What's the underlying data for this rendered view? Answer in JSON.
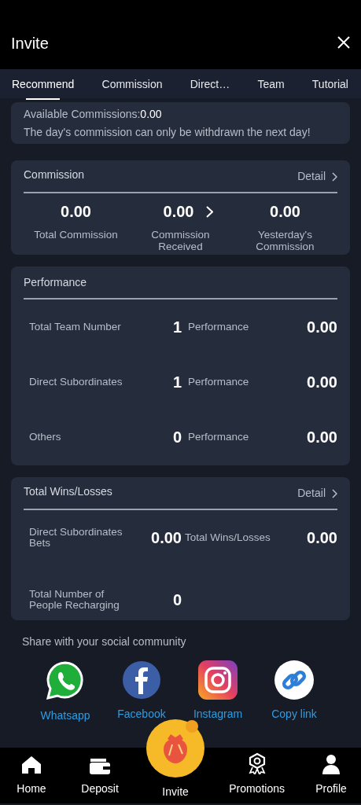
{
  "header": {
    "title": "Invite"
  },
  "tabs": [
    {
      "label": "Recommend",
      "selected": true
    },
    {
      "label": "Commission",
      "selected": false
    },
    {
      "label": "Direct…",
      "selected": false
    },
    {
      "label": "Team",
      "selected": false
    },
    {
      "label": "Tutorial",
      "selected": false
    }
  ],
  "balance_card": {
    "label": "Available Commissions:",
    "value": "0.00",
    "note": "The day's commission can only be withdrawn the next day!"
  },
  "commission_card": {
    "title": "Commission",
    "detail_link": "Detail",
    "stats": [
      {
        "value": "0.00",
        "label": "Total Commission",
        "has_arrow": false
      },
      {
        "value": "0.00",
        "label": "Commission Received",
        "has_arrow": true
      },
      {
        "value": "0.00",
        "label": "Yesterday's Commission",
        "has_arrow": false
      }
    ]
  },
  "performance_card": {
    "title": "Performance",
    "rows": [
      {
        "label": "Total Team Number",
        "count": "1",
        "metric_label": "Performance",
        "metric_value": "0.00"
      },
      {
        "label": "Direct Subordinates",
        "count": "1",
        "metric_label": "Performance",
        "metric_value": "0.00"
      },
      {
        "label": "Others",
        "count": "0",
        "metric_label": "Performance",
        "metric_value": "0.00"
      }
    ]
  },
  "wins_card": {
    "title": "Total Wins/Losses",
    "detail_link": "Detail",
    "rows": [
      {
        "label": "Direct Subordinates Bets",
        "value": "0.00",
        "metric_label": "Total Wins/Losses",
        "metric_value": "0.00"
      },
      {
        "label": "Total Number of People Recharging",
        "value": "0"
      }
    ]
  },
  "share": {
    "title": "Share with your social community",
    "items": [
      {
        "kind": "whatsapp",
        "label": "Whatsapp"
      },
      {
        "kind": "facebook",
        "label": "Facebook"
      },
      {
        "kind": "instagram",
        "label": "Instagram"
      },
      {
        "kind": "link",
        "label": "Copy link"
      }
    ]
  },
  "bottom_nav": [
    {
      "kind": "home",
      "label": "Home"
    },
    {
      "kind": "wallet",
      "label": "Deposit"
    },
    {
      "kind": "invite",
      "label": "Invite"
    },
    {
      "kind": "promotions",
      "label": "Promotions"
    },
    {
      "kind": "profile",
      "label": "Profile"
    }
  ]
}
